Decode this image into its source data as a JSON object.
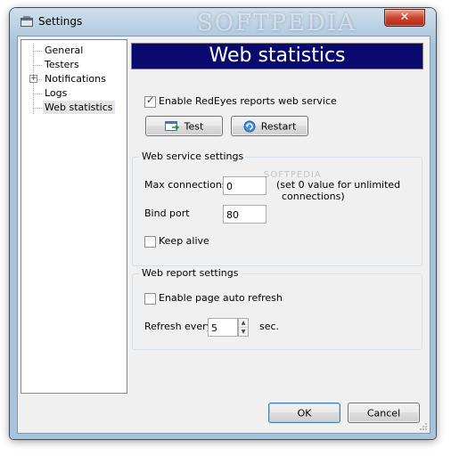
{
  "window": {
    "title": "Settings",
    "watermark": "SOFTPEDIA",
    "close_label": "✕"
  },
  "tree": {
    "items": [
      {
        "label": "General"
      },
      {
        "label": "Testers"
      },
      {
        "label": "Notifications",
        "expander": "+"
      },
      {
        "label": "Logs"
      },
      {
        "label": "Web statistics",
        "selected": true
      }
    ]
  },
  "panel": {
    "header": "Web statistics",
    "enable_reports_label": "Enable RedEyes reports web service",
    "enable_reports_checked": true,
    "test_button": "Test",
    "restart_button": "Restart"
  },
  "web_service": {
    "group_title": "Web service settings",
    "max_connections_label": "Max connections",
    "max_connections_value": "0",
    "max_connections_hint_line1": "(set 0 value for unlimited",
    "max_connections_hint_line2": "connections)",
    "bind_port_label": "Bind port",
    "bind_port_value": "80",
    "keep_alive_label": "Keep alive",
    "keep_alive_checked": false,
    "watermark": "SOFTPEDIA"
  },
  "web_report": {
    "group_title": "Web report settings",
    "auto_refresh_label": "Enable page auto refresh",
    "auto_refresh_checked": false,
    "refresh_every_label": "Refresh every",
    "refresh_every_value": "5",
    "refresh_unit": "sec."
  },
  "footer": {
    "ok_button": "OK",
    "cancel_button": "Cancel"
  },
  "colors": {
    "header_band": "#0a0a6e",
    "checkmark": "#1d3d7a"
  },
  "icons": {
    "app": "settings-app-icon",
    "test": "test-icon",
    "restart": "restart-icon",
    "close": "close-icon"
  }
}
